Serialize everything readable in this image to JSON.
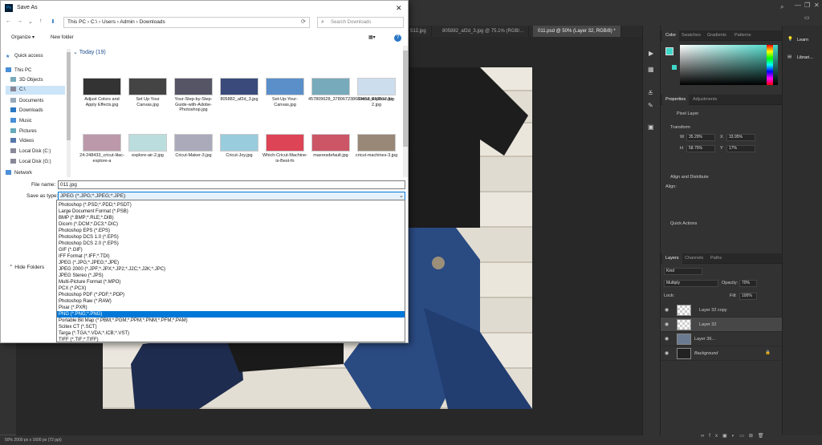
{
  "dialog": {
    "title": "Save As",
    "address": "This PC  ›  C:\\  ›  Users  ›  Admin  ›  Downloads",
    "search_placeholder": "Search Downloads",
    "organize": "Organize ▾",
    "new_folder": "New folder",
    "group_header": "Today (19)",
    "nav": [
      {
        "label": "Quick access",
        "icon": "star-icon"
      },
      {
        "label": "This PC",
        "icon": "computer-icon"
      },
      {
        "label": "3D Objects",
        "icon": "cube-icon"
      },
      {
        "label": "C:\\",
        "icon": "drive-icon"
      },
      {
        "label": "Documents",
        "icon": "documents-icon"
      },
      {
        "label": "Downloads",
        "icon": "download-icon"
      },
      {
        "label": "Music",
        "icon": "music-icon"
      },
      {
        "label": "Pictures",
        "icon": "pictures-icon"
      },
      {
        "label": "Videos",
        "icon": "video-icon"
      },
      {
        "label": "Local Disk (C:)",
        "icon": "drive-icon"
      },
      {
        "label": "Local Disk (G:)",
        "icon": "drive-icon"
      },
      {
        "label": "Network",
        "icon": "network-icon"
      }
    ],
    "files": [
      {
        "name": "Adjust Colors and Apply Effects.jpg",
        "color": "#333"
      },
      {
        "name": "Set Up Your Canvas.jpg",
        "color": "#444"
      },
      {
        "name": "Your-Step-by-Step-Guide-with-Adobe-Photoshop.jpg",
        "color": "#556"
      },
      {
        "name": "805882_af2d_3.jpg",
        "color": "#3a4a7a"
      },
      {
        "name": "Set-Up-Your-Canvas.jpg",
        "color": "#5b8fc9"
      },
      {
        "name": "457809628_378067238684458_453512.jpg",
        "color": "#7ab"
      },
      {
        "name": "Cricut-Explore-Air-2.jpg",
        "color": "#cde"
      },
      {
        "name": "24-248433_cricut-lilac-explore-a",
        "color": "#b9a"
      },
      {
        "name": "explore-air-2.jpg",
        "color": "#bdd"
      },
      {
        "name": "Cricut-Maker-3.jpg",
        "color": "#aab"
      },
      {
        "name": "Cricut-Joy.jpg",
        "color": "#9cd"
      },
      {
        "name": "Which-Cricut-Machine-is-Best-fo",
        "color": "#d45"
      },
      {
        "name": "maxresdefault.jpg",
        "color": "#c56"
      },
      {
        "name": "cricut-machines-3.jpg",
        "color": "#987"
      }
    ],
    "file_name_label": "File name:",
    "file_name_value": "011.jpg",
    "save_as_type_label": "Save as type:",
    "save_as_type_value": "JPEG (*.JPG;*.JPEG;*.JPE)",
    "hide_folders": "Hide Folders",
    "type_options": [
      "Photoshop (*.PSD;*.PDD;*.PSDT)",
      "Large Document Format (*.PSB)",
      "BMP (*.BMP;*.RLE;*.DIB)",
      "Dicom (*.DCM;*.DC3;*.DIC)",
      "Photoshop EPS (*.EPS)",
      "Photoshop DCS 1.0 (*.EPS)",
      "Photoshop DCS 2.0 (*.EPS)",
      "GIF (*.GIF)",
      "IFF Format (*.IFF;*.TDI)",
      "JPEG (*.JPG;*.JPEG;*.JPE)",
      "JPEG 2000 (*.JPF;*.JPX;*.JP2;*.J2C;*.J2K;*.JPC)",
      "JPEG Stereo (*.JPS)",
      "Multi-Picture Format (*.MPO)",
      "PCX (*.PCX)",
      "Photoshop PDF (*.PDF;*.PDP)",
      "Photoshop Raw (*.RAW)",
      "Pixar (*.PXR)",
      "PNG (*.PNG;*.PNG)",
      "Portable Bit Map (*.PBM;*.PGM;*.PPM;*.PNM;*.PFM;*.PAM)",
      "Scitex CT (*.SCT)",
      "Targa (*.TGA;*.VDA;*.ICB;*.VST)",
      "TIFF (*.TIF;*.TIFF)"
    ],
    "selected_type_index": 17
  },
  "ps": {
    "tabs": [
      "512.jpg",
      "805882_af2d_3.jpg @ 75.1% (RGB/...",
      "011.psd @ 50% (Layer 32, RGB/8) *"
    ],
    "status": "50%      2000 px x 1600 px (72 ppi)",
    "color_tabs": [
      "Color",
      "Swatches",
      "Gradients",
      "Patterns"
    ],
    "prop_tabs": [
      "Properties",
      "Adjustments"
    ],
    "pixel_layer": "Pixel Layer",
    "transform": "Transform",
    "w_label": "W",
    "w_val": "35.29%",
    "x_label": "X",
    "x_val": "33.95%",
    "h_label": "H",
    "h_val": "58.75%",
    "y_label": "Y",
    "y_val": "17%",
    "align": "Align and Distribute",
    "align_sub": "Align:",
    "quick": "Quick Actions",
    "layers_tabs": [
      "Layers",
      "Channels",
      "Paths"
    ],
    "kind": "Kind",
    "blend": "Multiply",
    "opacity_label": "Opacity:",
    "opacity_val": "70%",
    "lock_label": "Lock:",
    "fill_label": "Fill:",
    "fill_val": "100%",
    "layers": [
      "Layer 32 copy",
      "Layer 32",
      "Layer 36...",
      "Background"
    ],
    "learn": "Learn",
    "libraries": "Librari..."
  }
}
